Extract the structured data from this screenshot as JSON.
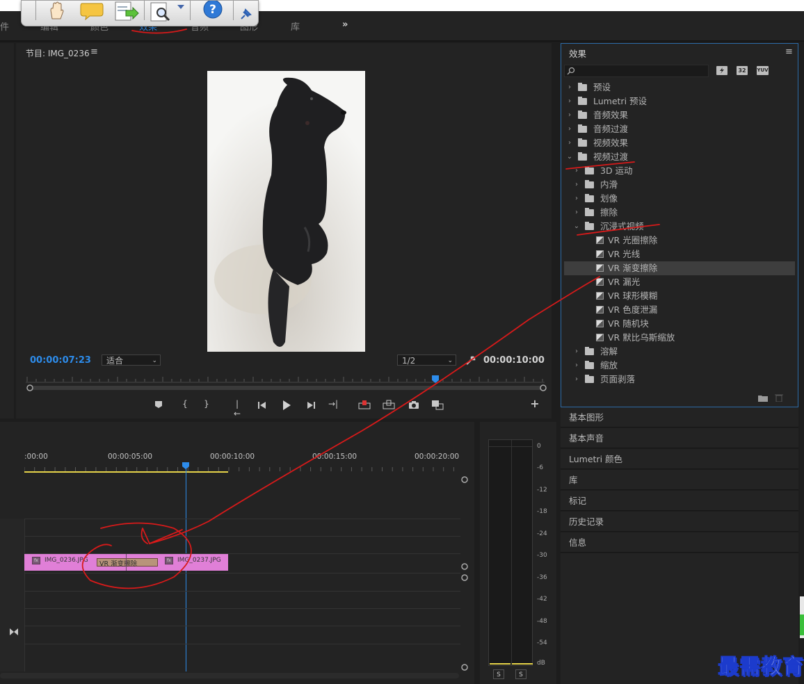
{
  "workspace_tabs": [
    "件",
    "编辑",
    "颜色",
    "效果",
    "音频",
    "图形",
    "库"
  ],
  "more_tabs_icon": "»",
  "program_monitor": {
    "title": "节目: IMG_0236",
    "menu_icon": "≡",
    "timecode_current": "00:00:07:23",
    "fit_dropdown": "适合",
    "resolution_dropdown": "1/2",
    "timecode_duration": "00:00:10:00"
  },
  "timeline": {
    "ruler_labels": [
      ":00:00",
      "00:00:05:00",
      "00:00:10:00",
      "00:00:15:00",
      "00:00:20:00"
    ],
    "clips": [
      {
        "label": "IMG_0236.JPG",
        "badge": "fx"
      },
      {
        "label": "IMG_0237.JPG",
        "badge": "fx"
      }
    ],
    "transition_label": "VR 渐变擦除"
  },
  "audio_meter": {
    "scale": [
      "0",
      "-6",
      "-12",
      "-18",
      "-24",
      "-30",
      "-36",
      "-42",
      "-48",
      "-54",
      "dB"
    ],
    "solo_buttons": [
      "S",
      "S"
    ]
  },
  "effects_panel": {
    "title": "效果",
    "menu_icon": "≡",
    "search_placeholder": "",
    "badges": [
      "32",
      "YUV"
    ],
    "tree": [
      {
        "label": "预设",
        "level": 0,
        "expanded": false,
        "type": "preset-folder"
      },
      {
        "label": "Lumetri 预设",
        "level": 0,
        "expanded": false,
        "type": "preset-folder"
      },
      {
        "label": "音频效果",
        "level": 0,
        "expanded": false,
        "type": "folder"
      },
      {
        "label": "音频过渡",
        "level": 0,
        "expanded": false,
        "type": "folder"
      },
      {
        "label": "视频效果",
        "level": 0,
        "expanded": false,
        "type": "folder"
      },
      {
        "label": "视频过渡",
        "level": 0,
        "expanded": true,
        "type": "folder"
      },
      {
        "label": "3D 运动",
        "level": 1,
        "expanded": false,
        "type": "folder"
      },
      {
        "label": "内滑",
        "level": 1,
        "expanded": false,
        "type": "folder"
      },
      {
        "label": "划像",
        "level": 1,
        "expanded": false,
        "type": "folder"
      },
      {
        "label": "擦除",
        "level": 1,
        "expanded": false,
        "type": "folder"
      },
      {
        "label": "沉浸式视频",
        "level": 1,
        "expanded": true,
        "type": "folder"
      },
      {
        "label": "VR 光圈擦除",
        "level": 2,
        "type": "effect"
      },
      {
        "label": "VR 光线",
        "level": 2,
        "type": "effect"
      },
      {
        "label": "VR 渐变擦除",
        "level": 2,
        "type": "effect",
        "selected": true
      },
      {
        "label": "VR 漏光",
        "level": 2,
        "type": "effect"
      },
      {
        "label": "VR 球形模糊",
        "level": 2,
        "type": "effect"
      },
      {
        "label": "VR 色度泄漏",
        "level": 2,
        "type": "effect"
      },
      {
        "label": "VR 随机块",
        "level": 2,
        "type": "effect"
      },
      {
        "label": "VR 默比乌斯缩放",
        "level": 2,
        "type": "effect"
      },
      {
        "label": "溶解",
        "level": 1,
        "expanded": false,
        "type": "folder"
      },
      {
        "label": "缩放",
        "level": 1,
        "expanded": false,
        "type": "folder"
      },
      {
        "label": "页面剥落",
        "level": 1,
        "expanded": false,
        "type": "folder"
      }
    ]
  },
  "side_panels": [
    "基本图形",
    "基本声音",
    "Lumetri 颜色",
    "库",
    "标记",
    "历史记录",
    "信息"
  ],
  "watermark": "最需教育",
  "colors": {
    "accent_blue": "#2d8ceb",
    "clip_pink": "#e07fd7",
    "transition_tan": "#b8947a",
    "annotation_red": "#d81a1a"
  }
}
